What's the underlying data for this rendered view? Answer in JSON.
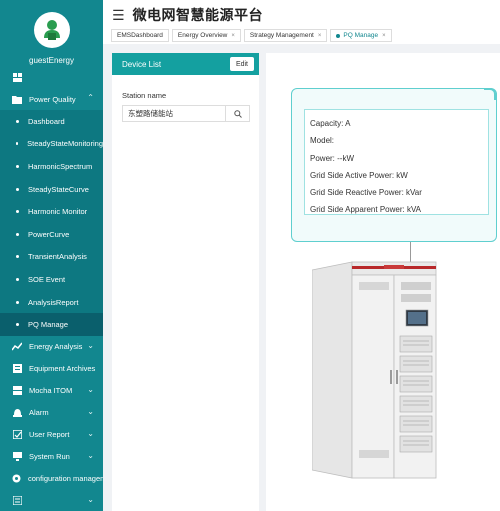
{
  "app": {
    "title": "微电网智慧能源平台"
  },
  "sidebar": {
    "username": "guestEnergy",
    "items": [
      {
        "label": "",
        "icon": "dashboard-icon",
        "has_children": false
      },
      {
        "label": "Power Quality",
        "icon": "folder-icon",
        "has_children": true,
        "expanded": true
      },
      {
        "label": "Energy Analysis",
        "icon": "chart-icon",
        "has_children": true
      },
      {
        "label": "Equipment Archives",
        "icon": "archive-icon",
        "has_children": false
      },
      {
        "label": "Mocha ITOM",
        "icon": "server-icon",
        "has_children": true
      },
      {
        "label": "Alarm",
        "icon": "alarm-icon",
        "has_children": true
      },
      {
        "label": "User Report",
        "icon": "report-icon",
        "has_children": true
      },
      {
        "label": "System Run",
        "icon": "system-icon",
        "has_children": true
      },
      {
        "label": "configuration management",
        "icon": "config-icon",
        "has_children": false
      },
      {
        "label": "",
        "icon": "settings-icon",
        "has_children": true
      }
    ],
    "power_quality_children": [
      "Dashboard",
      "SteadyStateMonitoring",
      "HarmonicSpectrum",
      "SteadyStateCurve",
      "Harmonic Monitor",
      "PowerCurve",
      "TransientAnalysis",
      "SOE Event",
      "AnalysisReport",
      "PQ Manage"
    ],
    "active_child": "PQ Manage"
  },
  "tabs": [
    {
      "label": "EMSDashboard",
      "closable": false,
      "active": false
    },
    {
      "label": "Energy Overview",
      "closable": true,
      "active": false
    },
    {
      "label": "Strategy Management",
      "closable": true,
      "active": false
    },
    {
      "label": "PQ Manage",
      "closable": true,
      "active": true
    }
  ],
  "device_list": {
    "title": "Device List",
    "edit_label": "Edit",
    "station_label": "Station name",
    "station_value": "东塑路储能站"
  },
  "device_info": {
    "capacity": "Capacity:  A",
    "model": "Model:",
    "power": "Power:  --kW",
    "grid_active": "Grid Side Active Power:  kW",
    "grid_reactive": "Grid Side Reactive Power:  kVar",
    "grid_apparent": "Grid Side Apparent Power:  kVA"
  },
  "colors": {
    "sidebar": "#12878f",
    "sidebar_submenu": "#0d7881",
    "active_item": "#0a5f6c",
    "panel_header": "#14a0a0",
    "card_border": "#5fcfcf"
  }
}
